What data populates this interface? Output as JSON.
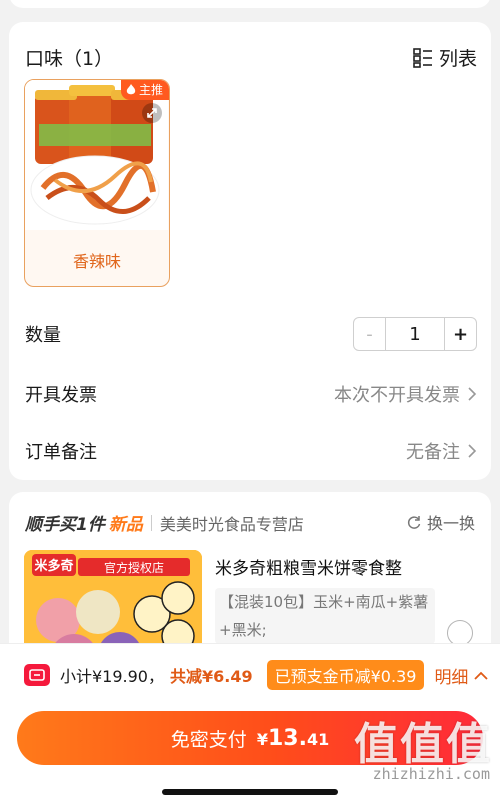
{
  "flavor": {
    "header": "口味（1）",
    "view_toggle": "列表",
    "badge": "主推",
    "item_label": "香辣味"
  },
  "quantity": {
    "label": "数量",
    "minus": "-",
    "value": "1",
    "plus": "+"
  },
  "invoice": {
    "label": "开具发票",
    "value": "本次不开具发票"
  },
  "remark": {
    "label": "订单备注",
    "value": "无备注"
  },
  "bundle": {
    "title": "顺手买1件",
    "new": "新品",
    "store": "美美时光食品专营店",
    "swap": "换一换",
    "product_title": "米多奇粗粮雪米饼零食整",
    "product_desc": "【混装10包】玉米+南瓜+紫薯+黑米;",
    "image_text": "官方授权店",
    "image_brand": "米多奇"
  },
  "summary": {
    "subtotal": "小计¥19.90，",
    "reduce": "共减¥6.49",
    "coin": "已预支金币减¥0.39",
    "detail": "明细"
  },
  "pay": {
    "label": "免密支付",
    "currency": "¥",
    "amount_main": "13.",
    "amount_cents": "41"
  },
  "watermark": {
    "logo": "值值值",
    "site": "zhizhizhi.com"
  },
  "colors": {
    "accent": "#ff5a1f",
    "orange_text": "#e0661c",
    "coin_badge": "#ff8c1a"
  }
}
